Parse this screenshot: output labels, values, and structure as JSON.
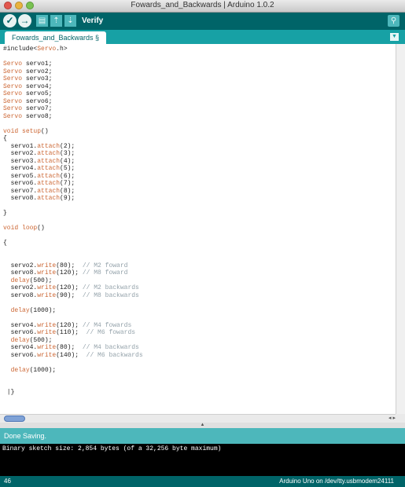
{
  "window": {
    "title": "Fowards_and_Backwards | Arduino 1.0.2"
  },
  "toolbar": {
    "verify_label": "Verify",
    "buttons": [
      "verify-icon",
      "upload-icon",
      "new-icon",
      "open-icon",
      "save-icon"
    ],
    "serial_monitor_icon": "magnifier-icon"
  },
  "tab": {
    "label": "Fowards_and_Backwards §"
  },
  "code_lines": [
    [
      {
        "t": "#include<"
      },
      {
        "t": "Servo",
        "c": "kw"
      },
      {
        "t": ".h>"
      }
    ],
    [],
    [
      {
        "t": "Servo",
        "c": "kw"
      },
      {
        "t": " servo1;"
      }
    ],
    [
      {
        "t": "Servo",
        "c": "kw"
      },
      {
        "t": " servo2;"
      }
    ],
    [
      {
        "t": "Servo",
        "c": "kw"
      },
      {
        "t": " servo3;"
      }
    ],
    [
      {
        "t": "Servo",
        "c": "kw"
      },
      {
        "t": " servo4;"
      }
    ],
    [
      {
        "t": "Servo",
        "c": "kw"
      },
      {
        "t": " servo5;"
      }
    ],
    [
      {
        "t": "Servo",
        "c": "kw"
      },
      {
        "t": " servo6;"
      }
    ],
    [
      {
        "t": "Servo",
        "c": "kw"
      },
      {
        "t": " servo7;"
      }
    ],
    [
      {
        "t": "Servo",
        "c": "kw"
      },
      {
        "t": " servo8;"
      }
    ],
    [],
    [
      {
        "t": "void",
        "c": "kw"
      },
      {
        "t": " "
      },
      {
        "t": "setup",
        "c": "kw"
      },
      {
        "t": "()"
      }
    ],
    [
      {
        "t": "{"
      }
    ],
    [
      {
        "t": "  servo1."
      },
      {
        "t": "attach",
        "c": "kw"
      },
      {
        "t": "(2);"
      }
    ],
    [
      {
        "t": "  servo2."
      },
      {
        "t": "attach",
        "c": "kw"
      },
      {
        "t": "(3);"
      }
    ],
    [
      {
        "t": "  servo3."
      },
      {
        "t": "attach",
        "c": "kw"
      },
      {
        "t": "(4);"
      }
    ],
    [
      {
        "t": "  servo4."
      },
      {
        "t": "attach",
        "c": "kw"
      },
      {
        "t": "(5);"
      }
    ],
    [
      {
        "t": "  servo5."
      },
      {
        "t": "attach",
        "c": "kw"
      },
      {
        "t": "(6);"
      }
    ],
    [
      {
        "t": "  servo6."
      },
      {
        "t": "attach",
        "c": "kw"
      },
      {
        "t": "(7);"
      }
    ],
    [
      {
        "t": "  servo7."
      },
      {
        "t": "attach",
        "c": "kw"
      },
      {
        "t": "(8);"
      }
    ],
    [
      {
        "t": "  servo8."
      },
      {
        "t": "attach",
        "c": "kw"
      },
      {
        "t": "(9);"
      }
    ],
    [],
    [
      {
        "t": "}"
      }
    ],
    [],
    [
      {
        "t": "void",
        "c": "kw"
      },
      {
        "t": " "
      },
      {
        "t": "loop",
        "c": "kw"
      },
      {
        "t": "()"
      }
    ],
    [],
    [
      {
        "t": "{"
      }
    ],
    [],
    [],
    [
      {
        "t": "  servo2."
      },
      {
        "t": "write",
        "c": "kw"
      },
      {
        "t": "(80);  "
      },
      {
        "t": "// M2 foward",
        "c": "cm"
      }
    ],
    [
      {
        "t": "  servo8."
      },
      {
        "t": "write",
        "c": "kw"
      },
      {
        "t": "(120); "
      },
      {
        "t": "// M8 foward",
        "c": "cm"
      }
    ],
    [
      {
        "t": "  "
      },
      {
        "t": "delay",
        "c": "kw"
      },
      {
        "t": "(500);"
      }
    ],
    [
      {
        "t": "  servo2."
      },
      {
        "t": "write",
        "c": "kw"
      },
      {
        "t": "(120); "
      },
      {
        "t": "// M2 backwards",
        "c": "cm"
      }
    ],
    [
      {
        "t": "  servo8."
      },
      {
        "t": "write",
        "c": "kw"
      },
      {
        "t": "(90);  "
      },
      {
        "t": "// M8 backwards",
        "c": "cm"
      }
    ],
    [],
    [
      {
        "t": "  "
      },
      {
        "t": "delay",
        "c": "kw"
      },
      {
        "t": "(1000);"
      }
    ],
    [],
    [
      {
        "t": "  servo4."
      },
      {
        "t": "write",
        "c": "kw"
      },
      {
        "t": "(120); "
      },
      {
        "t": "// M4 fowards",
        "c": "cm"
      }
    ],
    [
      {
        "t": "  servo6."
      },
      {
        "t": "write",
        "c": "kw"
      },
      {
        "t": "(110);  "
      },
      {
        "t": "// M6 fowards",
        "c": "cm"
      }
    ],
    [
      {
        "t": "  "
      },
      {
        "t": "delay",
        "c": "kw"
      },
      {
        "t": "(500);"
      }
    ],
    [
      {
        "t": "  servo4."
      },
      {
        "t": "write",
        "c": "kw"
      },
      {
        "t": "(80);  "
      },
      {
        "t": "// M4 backwards",
        "c": "cm"
      }
    ],
    [
      {
        "t": "  servo6."
      },
      {
        "t": "write",
        "c": "kw"
      },
      {
        "t": "(140);  "
      },
      {
        "t": "// M6 backwards",
        "c": "cm"
      }
    ],
    [],
    [
      {
        "t": "  "
      },
      {
        "t": "delay",
        "c": "kw"
      },
      {
        "t": "(1000);"
      }
    ],
    [],
    [],
    [
      {
        "t": " |}"
      }
    ]
  ],
  "status": {
    "message": "Done Saving."
  },
  "console": {
    "text": "Binary sketch size: 2,854 bytes (of a 32,256 byte maximum)"
  },
  "footer": {
    "line_number": "46",
    "board": "Arduino Uno on /dev/tty.usbmodem24111"
  },
  "colors": {
    "toolbar": "#006468",
    "tabbar": "#17a1a5",
    "status": "#4db7bb",
    "keyword": "#cc6633",
    "comment": "#95a3ab"
  }
}
